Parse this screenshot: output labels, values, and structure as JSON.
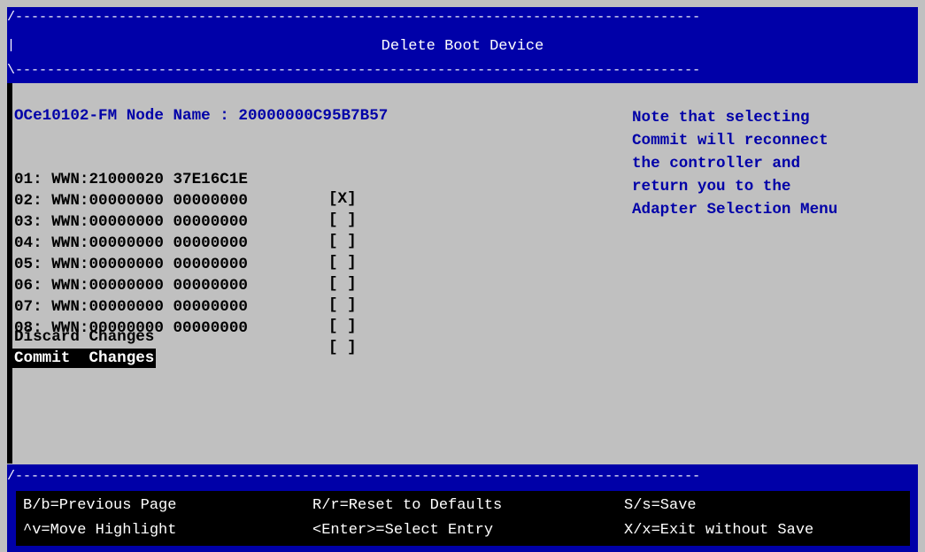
{
  "window": {
    "title": "Delete Boot Device"
  },
  "header": {
    "border_top": "/--------------------------------------------------------------------------------------",
    "border_mid": "|",
    "border_bottom": "\\--------------------------------------------------------------------------------------"
  },
  "adapter": {
    "node_line": "OCe10102-FM Node Name : 20000000C95B7B57"
  },
  "boot_devices": [
    {
      "label": "01: WWN:21000020 37E16C1E",
      "checkbox": "[X]"
    },
    {
      "label": "02: WWN:00000000 00000000",
      "checkbox": "[ ]"
    },
    {
      "label": "03: WWN:00000000 00000000",
      "checkbox": "[ ]"
    },
    {
      "label": "04: WWN:00000000 00000000",
      "checkbox": "[ ]"
    },
    {
      "label": "05: WWN:00000000 00000000",
      "checkbox": "[ ]"
    },
    {
      "label": "06: WWN:00000000 00000000",
      "checkbox": "[ ]"
    },
    {
      "label": "07: WWN:00000000 00000000",
      "checkbox": "[ ]"
    },
    {
      "label": "08: WWN:00000000 00000000",
      "checkbox": "[ ]"
    }
  ],
  "actions": {
    "discard": "Discard Changes",
    "commit": "Commit  Changes"
  },
  "note": {
    "lines": [
      "Note that selecting",
      "Commit will reconnect",
      "the controller and",
      "return you to the",
      "Adapter Selection Menu"
    ]
  },
  "footer": {
    "border_top": "/--------------------------------------------------------------------------------------",
    "keys": [
      {
        "text": "B/b=Previous Page"
      },
      {
        "text": "R/r=Reset to Defaults"
      },
      {
        "text": "S/s=Save"
      },
      {
        "text": "^v=Move Highlight"
      },
      {
        "text": "<Enter>=Select Entry"
      },
      {
        "text": "X/x=Exit without Save"
      }
    ]
  },
  "colors": {
    "header_bg": "#0000a8",
    "body_bg": "#c0c0c0",
    "highlight_bg": "#000000",
    "note_text": "#0000a8"
  }
}
